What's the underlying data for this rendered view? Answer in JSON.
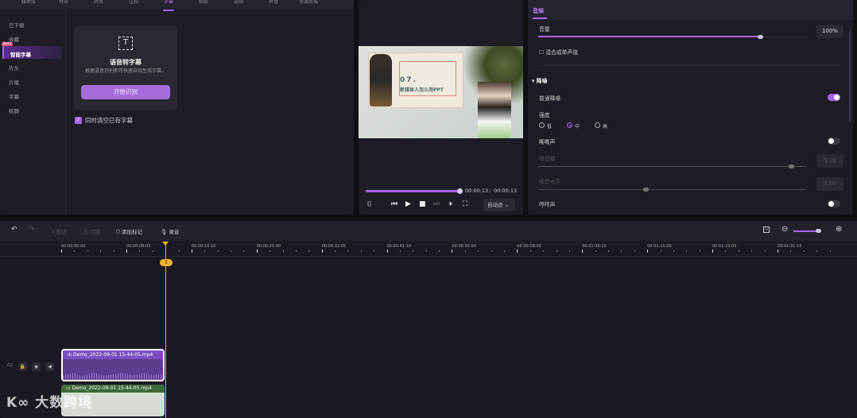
{
  "left_panel": {
    "tabs": [
      "媒体库",
      "特效",
      "转场",
      "注释",
      "字幕",
      "贴纸",
      "滤镜",
      "声音",
      "资源商城"
    ],
    "active_tab": "字幕",
    "sidebar": [
      "已下载",
      "收藏",
      "智能字幕",
      "片头",
      "片尾",
      "字幕",
      "标题"
    ],
    "beta_badge": "Beta",
    "card": {
      "icon": "text-recognition-icon",
      "title": "语音转字幕",
      "desc": "根据语音识别即可快速自动生成字幕。",
      "button": "开始识别"
    },
    "clear_checkbox": {
      "label": "同时清空已有字幕",
      "checked": true
    }
  },
  "preview": {
    "slide_num": "07.",
    "slide_title": "新媒体人怎么用PPT",
    "current_time": "00:00:13",
    "total_time": "00:00:13",
    "progress": 1.0,
    "zoom_select": "自动适"
  },
  "right_panel": {
    "tab": "音频",
    "volume_label": "音量",
    "volume_value": "100%",
    "volume_fraction": 0.82,
    "mono_label": "混合成单声道",
    "mono_checked": false,
    "denoise_section": "降噪",
    "normal_denoise": "普通降噪",
    "normal_denoise_on": true,
    "strength_label": "强度",
    "strength_options": [
      "低",
      "中",
      "高"
    ],
    "strength_selected": "中",
    "hiss": "嘶嘶声",
    "hiss_on": false,
    "noise_volume_label": "噪音量",
    "noise_volume_value": "5.00",
    "noise_level_label": "噪音水平",
    "noise_level_value": "3.00",
    "hum": "哼哼声",
    "hum_on": false
  },
  "timeline": {
    "toolbar": {
      "crop": "裁切",
      "split": "切割",
      "add_marker": "添加标记",
      "record": "录音"
    },
    "ruler": [
      "00:00:00:00",
      "00:00:08:05",
      "00:00:16:10",
      "00:00:25:00",
      "00:00:33:05",
      "00:00:41:10",
      "00:00:50:00",
      "00:00:58:05",
      "00:01:06:10",
      "00:01:15:00",
      "00:01:23:05",
      "00:01:31:10"
    ],
    "track_num": "02",
    "audio_clip": "Demo_2022-09-01 15-44-05.mp4",
    "video_clip": "Demo_2022-09-01 15-44-05.mp4"
  },
  "watermark": "大数跨境"
}
